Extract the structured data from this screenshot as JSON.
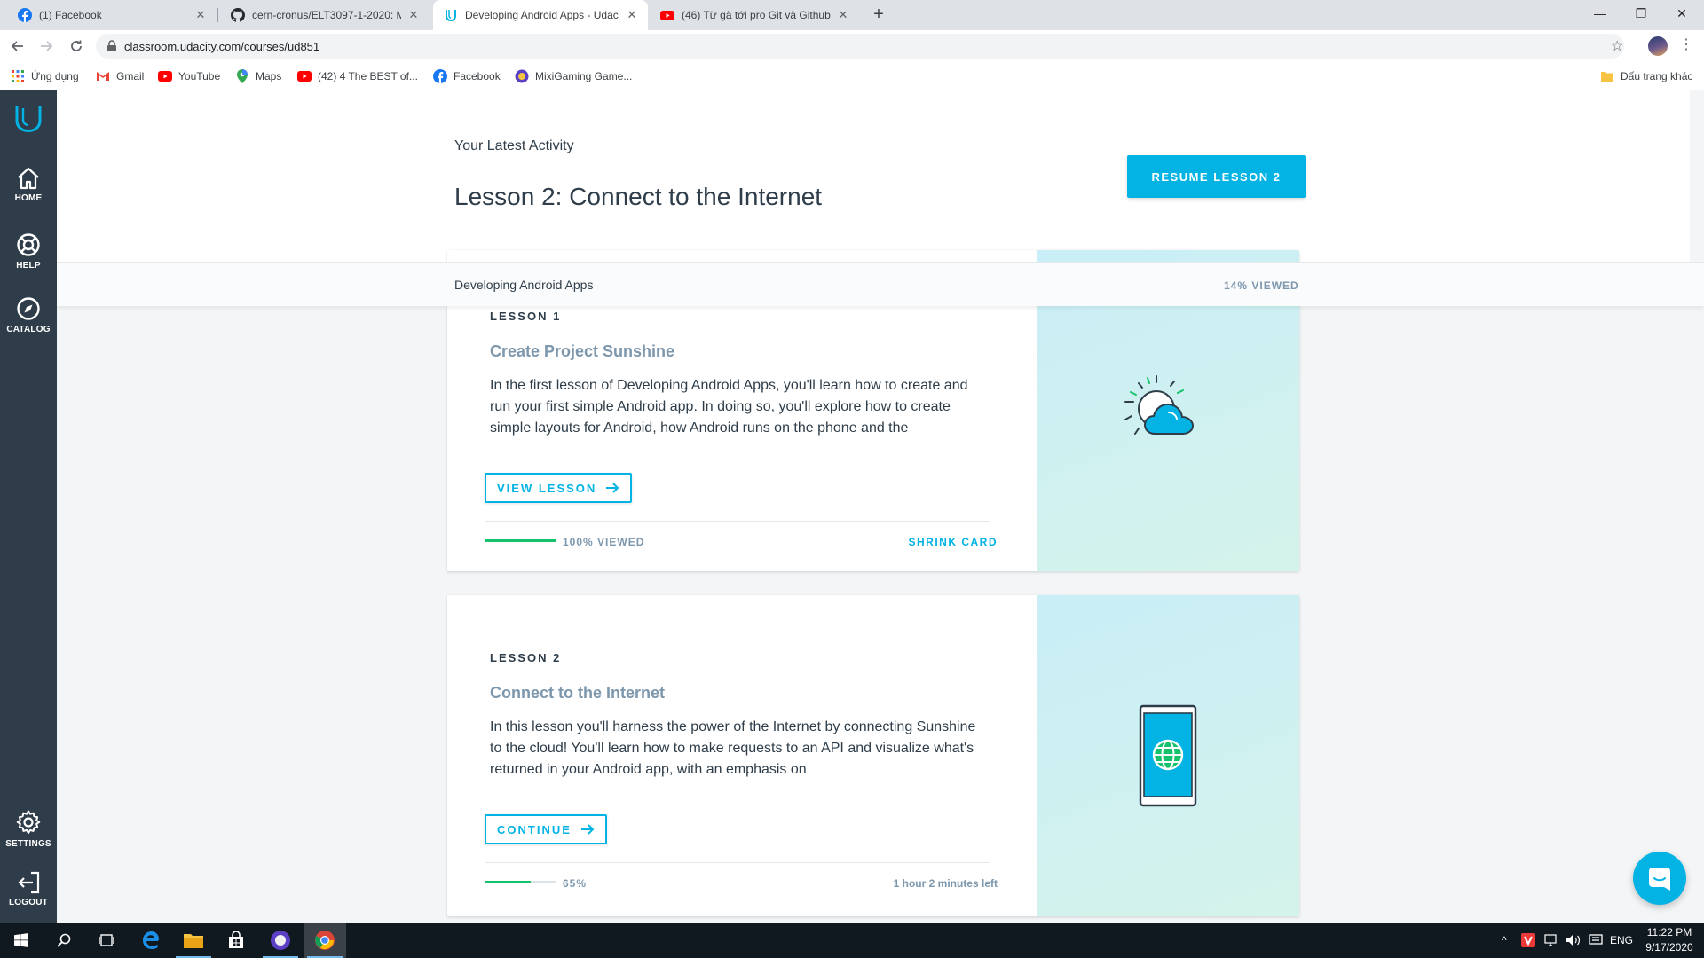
{
  "browser": {
    "tabs": [
      {
        "title": "(1) Facebook",
        "icon": "facebook-icon"
      },
      {
        "title": "cern-cronus/ELT3097-1-2020: Mô",
        "icon": "github-icon"
      },
      {
        "title": "Developing Android Apps - Udac",
        "icon": "udacity-icon"
      },
      {
        "title": "(46) Từ gà tới pro Git và Github t",
        "icon": "youtube-icon"
      }
    ],
    "url": "classroom.udacity.com/courses/ud851",
    "bookmarks": [
      {
        "label": "Ứng dụng",
        "icon": "apps-grid-icon"
      },
      {
        "label": "Gmail",
        "icon": "gmail-icon"
      },
      {
        "label": "YouTube",
        "icon": "youtube-icon"
      },
      {
        "label": "Maps",
        "icon": "maps-pin-icon"
      },
      {
        "label": "(42) 4 The BEST of...",
        "icon": "youtube-icon"
      },
      {
        "label": "Facebook",
        "icon": "facebook-icon"
      },
      {
        "label": "MixiGaming Game...",
        "icon": "mixigaming-icon"
      }
    ],
    "other_bookmarks": "Dấu trang khác"
  },
  "sidebar": {
    "items": [
      {
        "label": "HOME",
        "icon": "home-icon"
      },
      {
        "label": "HELP",
        "icon": "lifebuoy-icon"
      },
      {
        "label": "CATALOG",
        "icon": "compass-icon"
      },
      {
        "label": "SETTINGS",
        "icon": "gear-icon"
      },
      {
        "label": "LOGOUT",
        "icon": "logout-icon"
      }
    ]
  },
  "hero": {
    "latest_label": "Your Latest Activity",
    "lesson_title": "Lesson 2: Connect to the Internet",
    "resume_button": "RESUME LESSON 2"
  },
  "subbar": {
    "course_name": "Developing Android Apps",
    "viewed": "14% VIEWED"
  },
  "lessons": [
    {
      "kicker": "LESSON 1",
      "title": "Create Project Sunshine",
      "description": "In the first lesson of Developing Android Apps, you'll learn how to create and run your first simple Android app. In doing so, you'll explore how to create simple layouts for Android, how Android runs on the phone and the",
      "button": "VIEW LESSON",
      "progress": 1.0,
      "progress_label": "100% VIEWED",
      "footer_right": "SHRINK CARD",
      "art_icon": "sun-cloud-icon"
    },
    {
      "kicker": "LESSON 2",
      "title": "Connect to the Internet",
      "description": "In this lesson you'll harness the power of the Internet by connecting Sunshine to the cloud! You'll learn how to make requests to an API and visualize what's returned in your Android app, with an emphasis on",
      "button": "CONTINUE",
      "progress": 0.65,
      "progress_label": "65%",
      "footer_right": "1 hour 2 minutes left",
      "art_icon": "phone-globe-icon"
    }
  ],
  "taskbar": {
    "language": "ENG",
    "time": "11:22 PM",
    "date": "9/17/2020"
  },
  "colors": {
    "accent": "#02b3e4",
    "sidebar": "#2e3d49",
    "progress": "#15c26b",
    "muted": "#7d97ad"
  }
}
